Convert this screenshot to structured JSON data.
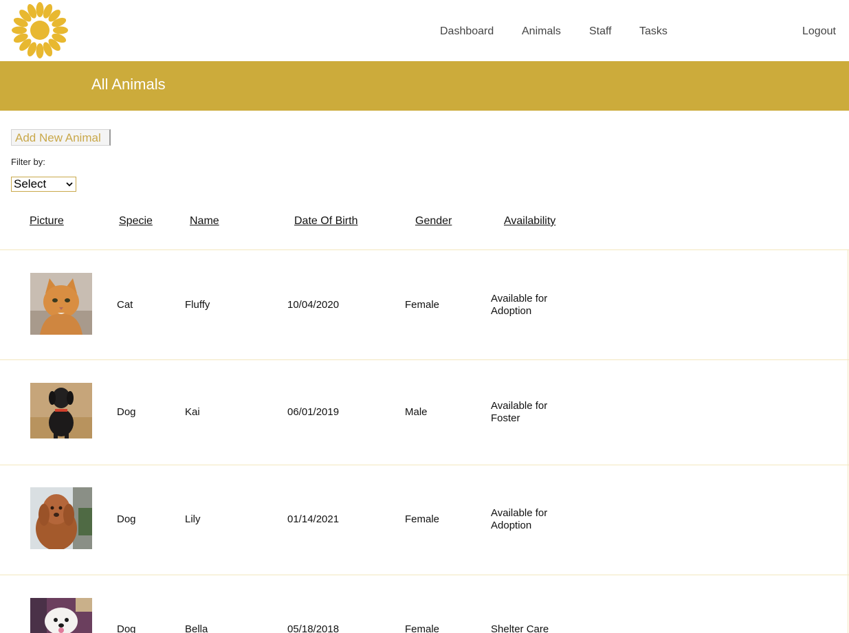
{
  "nav": {
    "dashboard": "Dashboard",
    "animals": "Animals",
    "staff": "Staff",
    "tasks": "Tasks",
    "logout": "Logout"
  },
  "banner": {
    "title": "All Animals"
  },
  "actions": {
    "add_new": "Add New Animal"
  },
  "filter": {
    "label": "Filter by:",
    "selected": "Select"
  },
  "table": {
    "headers": [
      "Picture",
      "Specie",
      "Name",
      "Date Of Birth",
      "Gender",
      "Availability"
    ],
    "rows": [
      {
        "specie": "Cat",
        "name": "Fluffy",
        "dob": "10/04/2020",
        "gender": "Female",
        "availability_line1": "Available for",
        "availability_line2": "Adoption"
      },
      {
        "specie": "Dog",
        "name": "Kai",
        "dob": "06/01/2019",
        "gender": "Male",
        "availability_line1": "Available for",
        "availability_line2": "Foster"
      },
      {
        "specie": "Dog",
        "name": "Lily",
        "dob": "01/14/2021",
        "gender": "Female",
        "availability_line1": "Available for",
        "availability_line2": "Adoption"
      },
      {
        "specie": "Dog",
        "name": "Bella",
        "dob": "05/18/2018",
        "gender": "Female",
        "availability_line1": "Shelter Care",
        "availability_line2": ""
      }
    ]
  },
  "colors": {
    "accent": "#ccab3b",
    "logo": "#e8b830",
    "divider": "#f3e7be"
  }
}
